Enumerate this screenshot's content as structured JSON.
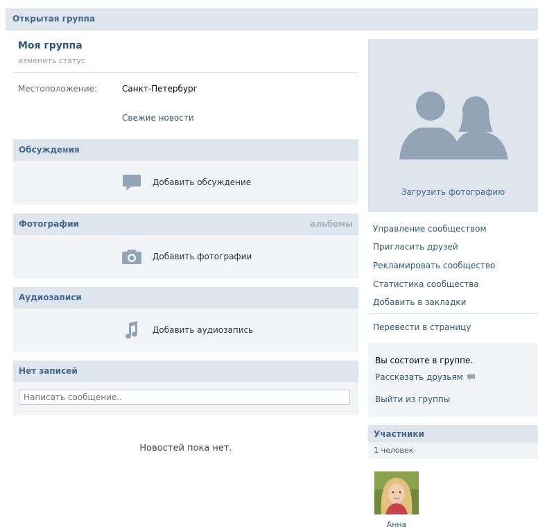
{
  "header": {
    "title": "Открытая группа"
  },
  "group": {
    "name": "Моя группа",
    "status_link": "изменить статус",
    "location_label": "Местоположение:",
    "location_value": "Санкт-Петербург",
    "news_link": "Свежие новости"
  },
  "sections": {
    "discussions": {
      "title": "Обсуждения",
      "action": "Добавить обсуждение",
      "icon": "speech-bubble-icon"
    },
    "photos": {
      "title": "Фотографии",
      "albums_link": "альбомы",
      "action": "Добавить фотографии",
      "icon": "camera-icon"
    },
    "audio": {
      "title": "Аудиозаписи",
      "action": "Добавить аудиозапись",
      "icon": "music-note-icon"
    },
    "wall": {
      "title": "Нет записей",
      "placeholder": "Написать сообщение..",
      "empty": "Новостей пока нет."
    }
  },
  "sidebar": {
    "upload_photo": "Загрузить фотографию",
    "menu": [
      "Управление сообществом",
      "Пригласить друзей",
      "Рекламировать сообщество",
      "Статистика сообщества",
      "Добавить в закладки"
    ],
    "convert": "Перевести в страницу",
    "membership": {
      "status": "Вы состоите в группе.",
      "tell_friends": "Рассказать друзьям",
      "leave": "Выйти из группы"
    },
    "members": {
      "title": "Участники",
      "count": "1 человек",
      "list": [
        {
          "name": "Анна"
        }
      ]
    }
  },
  "colors": {
    "accent": "#45688e",
    "link": "#2b587a",
    "header_bg": "#dfe5ec",
    "panel_bg": "#f2f4f7",
    "icon": "#93a4b6"
  }
}
